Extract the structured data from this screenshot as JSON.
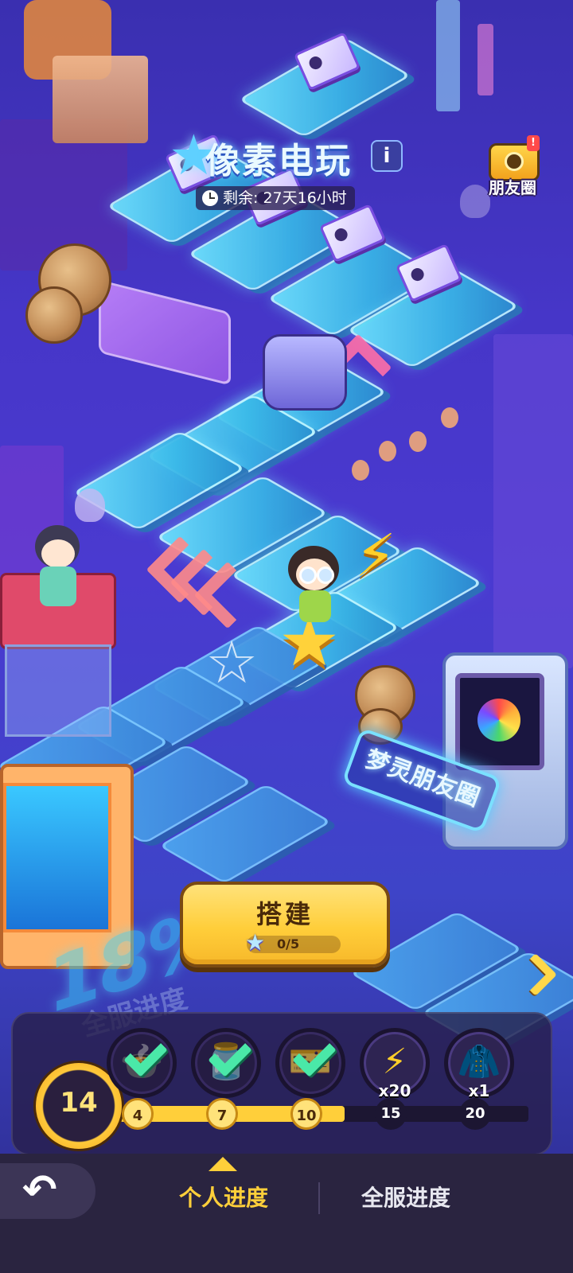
{
  "event": {
    "title": "像素电玩",
    "info_icon": "info-icon",
    "timer_label": "剩余: 27天16小时",
    "timer_icon": "clock-icon"
  },
  "friends_button": {
    "label": "朋友圈",
    "icon": "camera-icon",
    "badge": "!"
  },
  "scene": {
    "neon_sign": "梦灵朋友圈",
    "server_percent_neon": "18%",
    "server_progress_neon": "全服进度"
  },
  "build": {
    "label": "搭建",
    "cost_icon": "star-ticket-icon",
    "count": "0/5"
  },
  "progress": {
    "level": "14",
    "fill_fraction": 0.55,
    "rewards": [
      {
        "name": "reward-1",
        "milestone": "4",
        "claimed": true,
        "icon": "check-icon",
        "qty": ""
      },
      {
        "name": "reward-2",
        "milestone": "7",
        "claimed": true,
        "icon": "check-icon",
        "qty": ""
      },
      {
        "name": "reward-3",
        "milestone": "10",
        "claimed": true,
        "icon": "check-icon",
        "qty": ""
      },
      {
        "name": "reward-4",
        "milestone": "15",
        "claimed": false,
        "icon": "lightning-icon",
        "qty": "x20"
      },
      {
        "name": "reward-5",
        "milestone": "20",
        "claimed": false,
        "icon": "jacket-icon",
        "qty": "x1"
      }
    ]
  },
  "tabs": {
    "personal": "个人进度",
    "server": "全服进度",
    "active": "personal"
  },
  "colors": {
    "accent": "#ffcf3a",
    "tile": "#39b8e8",
    "background": "#4636c8",
    "check": "#4ae8a8"
  }
}
